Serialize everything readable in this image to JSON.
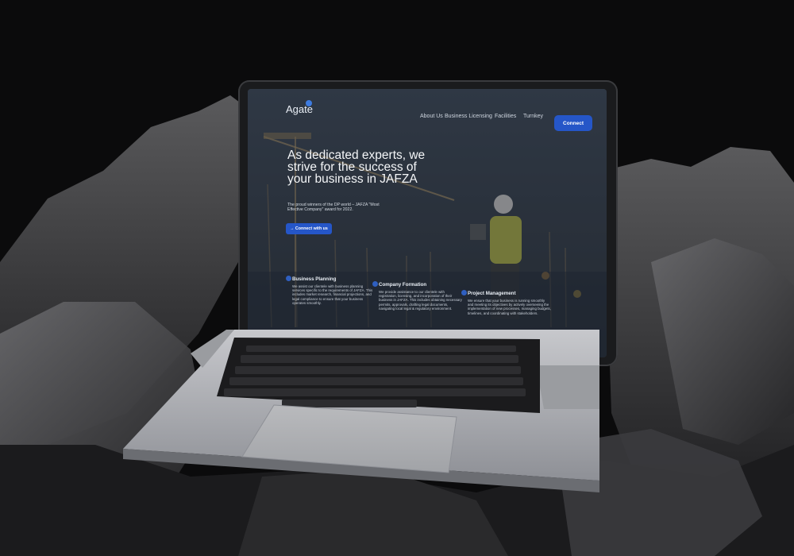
{
  "site": {
    "logo": "Agate",
    "nav": [
      "About Us",
      "Business Licensing",
      "Facilities",
      "Turnkey"
    ],
    "connect_button": "Connect",
    "hero": {
      "title": "As dedicated experts, we strive for the success of your business in JAFZA",
      "subtitle": "The proud winners of the DP world – JAFZA \"Most Effective Company\" award for 2022.",
      "button": "→ Connect with us"
    },
    "services": [
      {
        "title": "Business Planning",
        "text": "We assist our clientele with business planning services specific to the requirements of JAFZA. This includes market research, financial projections, and legal compliance to ensure that your business operates smoothly."
      },
      {
        "title": "Company Formation",
        "text": "We provide assistance to our clientele with registration, licensing, and incorporation of their business in JAFZA. This includes obtaining necessary permits, approvals, drafting legal documents, navigating local legal & regulatory environment."
      },
      {
        "title": "Project Management",
        "text": "We ensure that your business is running smoothly and meeting its objectives by actively overseeing the implementation of new processes, managing budgets, timelines, and coordinating with stakeholders."
      }
    ]
  },
  "colors": {
    "background": "#0b0b0c",
    "accent": "#2556c8"
  }
}
